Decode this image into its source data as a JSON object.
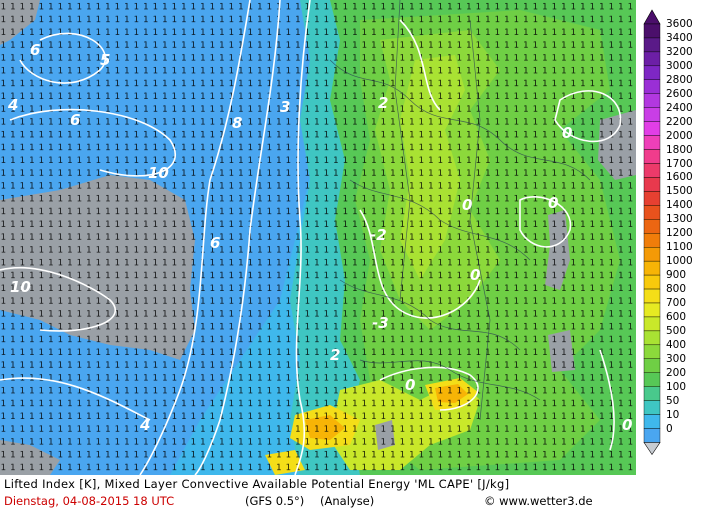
{
  "footer": {
    "title": "Lifted Index [K], Mixed Layer Convective Available Potential Energy 'ML CAPE' [J/kg]",
    "date": "Dienstag, 04-08-2015   18 UTC",
    "model": "(GFS 0.5°)",
    "run": "(Analyse)",
    "credit": "© www.wetter3.de"
  },
  "legend": {
    "units": "J/kg",
    "levels": [
      "3600",
      "3400",
      "3200",
      "3000",
      "2800",
      "2600",
      "2400",
      "2200",
      "2000",
      "1800",
      "1700",
      "1600",
      "1500",
      "1400",
      "1300",
      "1200",
      "1100",
      "1000",
      "900",
      "800",
      "700",
      "600",
      "500",
      "400",
      "300",
      "200",
      "100",
      "50",
      "10",
      "0"
    ],
    "colors": [
      "#4b0f6b",
      "#5a1a88",
      "#6c1fa6",
      "#7e27c4",
      "#9a2fd6",
      "#b238e0",
      "#c93ee6",
      "#e13ee6",
      "#ee3fb9",
      "#f03c8c",
      "#ec3a6a",
      "#e8394d",
      "#e64031",
      "#e8521d",
      "#ec6612",
      "#f07d0a",
      "#f49a06",
      "#f7b406",
      "#f8ca0c",
      "#f4de18",
      "#e6ea22",
      "#c9e82a",
      "#a9e233",
      "#8cd93b",
      "#6fcf45",
      "#57c856",
      "#49c98c",
      "#3fc6c2",
      "#3fb8ec",
      "#4aa6f0"
    ]
  },
  "map": {
    "colors": {
      "sea_gray": "#9aa0a6",
      "cape_0": "#4aa6f0",
      "cape_10": "#3fb8ec",
      "cape_50": "#3fc6c2",
      "cape_100": "#57c856",
      "cape_200": "#6fcf45",
      "cape_300": "#8cd93b",
      "cape_400": "#a9e233",
      "cape_500": "#c9e82a",
      "cape_600": "#e6ea22",
      "cape_800": "#f4de18",
      "cape_1000": "#f7b406",
      "contour_white": "#ffffff",
      "border": "#2a3b55"
    },
    "contour_labels": [
      "6",
      "4",
      "5",
      "6",
      "10",
      "8",
      "10",
      "3",
      "2",
      "0",
      "0",
      "-2",
      "0",
      "0",
      "-3",
      "0",
      "0",
      "2",
      "4",
      "6"
    ]
  }
}
